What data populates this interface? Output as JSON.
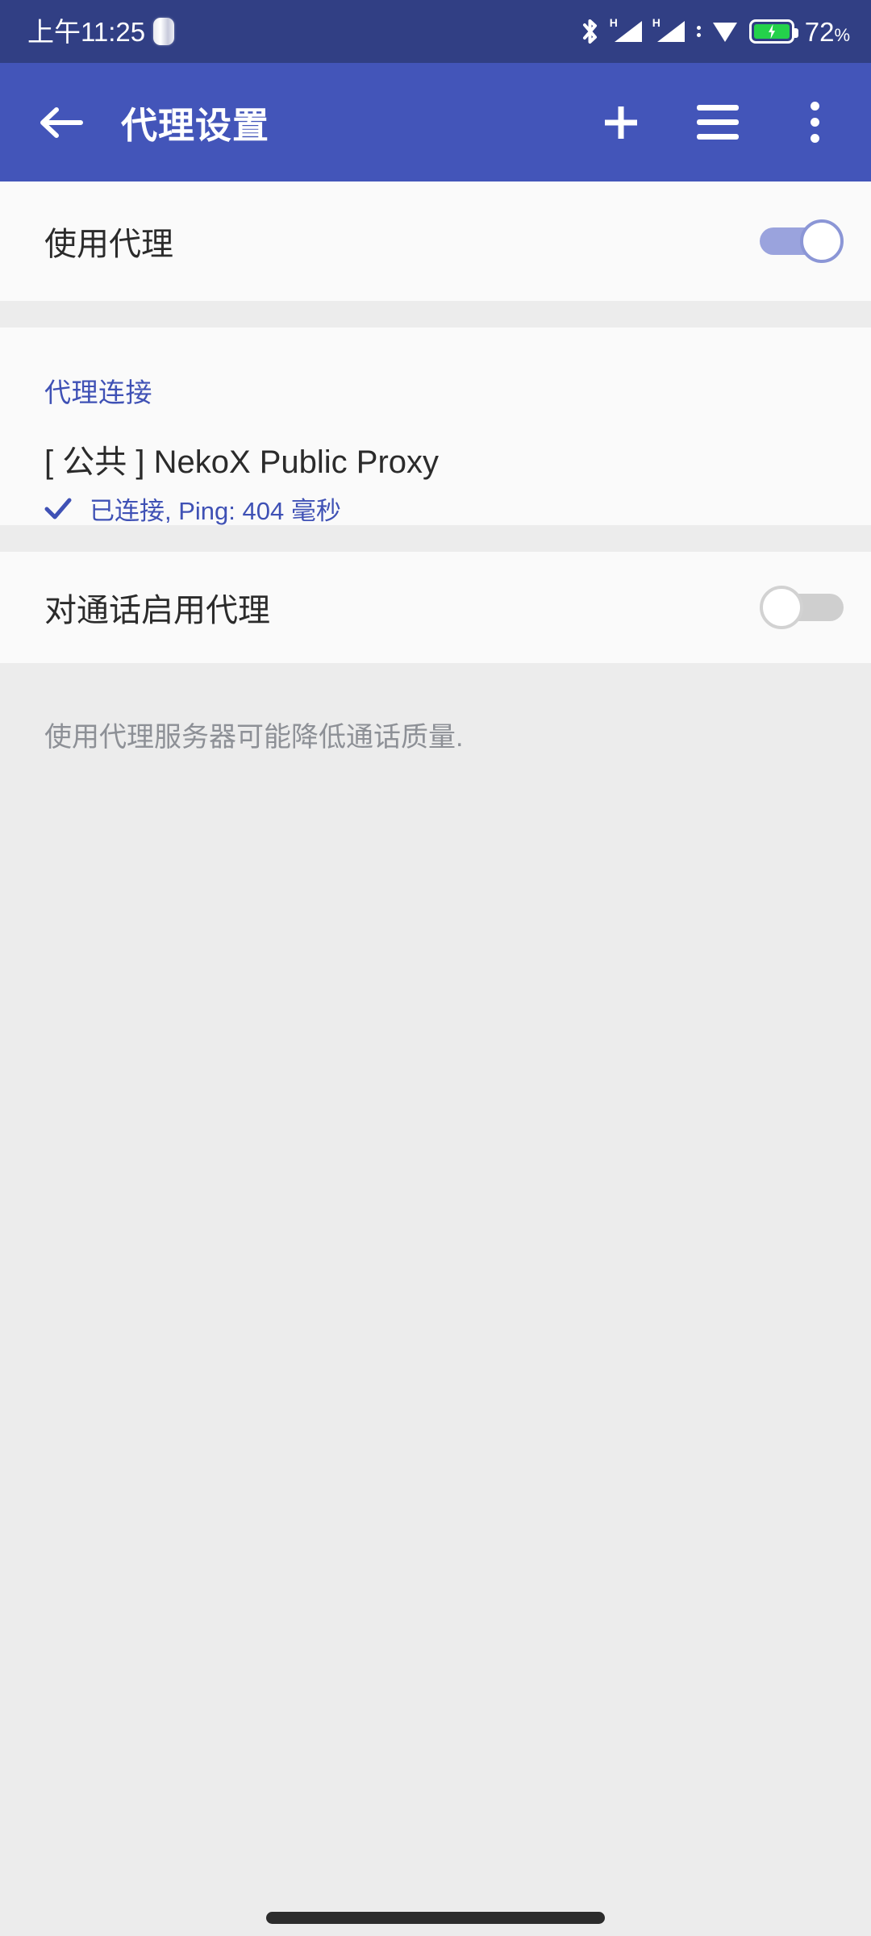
{
  "status_bar": {
    "clock": "上午11:25",
    "battery_percent": "72",
    "percent_symbol": "%",
    "icons": [
      "capsule-icon",
      "bluetooth-icon",
      "signal-h-icon",
      "signal-h-icon-2",
      "vpn-shield-icon",
      "battery-charging-icon"
    ],
    "signal_label": "H",
    "background_color": "#313f84"
  },
  "app_bar": {
    "title": "代理设置",
    "background_color": "#4355b9",
    "back_icon": "arrow-left-icon",
    "actions": [
      {
        "name": "add-proxy-button",
        "icon": "plus-icon"
      },
      {
        "name": "menu-button",
        "icon": "hamburger-icon"
      },
      {
        "name": "overflow-button",
        "icon": "kebab-icon"
      }
    ]
  },
  "sections": {
    "use_proxy": {
      "label": "使用代理",
      "toggle_state": "on"
    },
    "proxy_connection": {
      "header": "代理连接",
      "item_title": "[ 公共 ] NekoX Public Proxy",
      "item_status": "已连接, Ping: 404 毫秒",
      "status_icon": "check-icon",
      "accent_color": "#3f51b5"
    },
    "calls_proxy": {
      "label": "对通话启用代理",
      "toggle_state": "off"
    },
    "footnote": "使用代理服务器可能降低通话质量."
  },
  "navigation": {
    "gesture_pill": "home-indicator"
  },
  "colors": {
    "page_background": "#ececec",
    "row_background": "#fafafa",
    "primary_text": "#2b2b2b",
    "secondary_text": "#8d9096",
    "accent": "#3f51b5",
    "battery_green": "#24d14b"
  }
}
